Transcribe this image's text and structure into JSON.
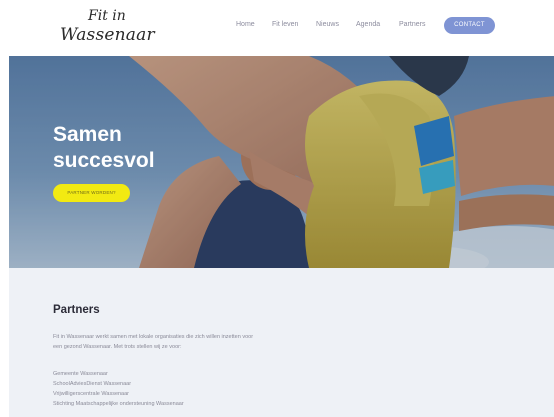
{
  "logo": {
    "line1": "Fit in",
    "line2": "Wassenaar"
  },
  "nav": {
    "items": [
      {
        "label": "Home"
      },
      {
        "label": "Fit leven"
      },
      {
        "label": "Nieuws"
      },
      {
        "label": "Agenda"
      },
      {
        "label": "Partners"
      }
    ],
    "contact_label": "CONTACT"
  },
  "hero": {
    "title_line1": "Samen",
    "title_line2": "succesvol",
    "button_label": "PARTNER WORDEN?"
  },
  "partners": {
    "title": "Partners",
    "intro_line1": "Fit in Wassenaar werkt samen met lokale organisaties die zich willen inzetten voor",
    "intro_line2": "een gezond Wassenaar. Met trots stellen wij ze voor:",
    "list": [
      "Gemeente Wassenaar",
      "SchoolAdviesDienst Wassenaar",
      "Vrijwilligerscentrale Wassenaar",
      "Stichting Maatschappelijke ondersteuning Wassenaar"
    ]
  },
  "colors": {
    "contact_button": "#7f94d4",
    "hero_button": "#f2ea12",
    "content_background": "#eef1f6",
    "hero_sky": "#5f7fa6"
  }
}
